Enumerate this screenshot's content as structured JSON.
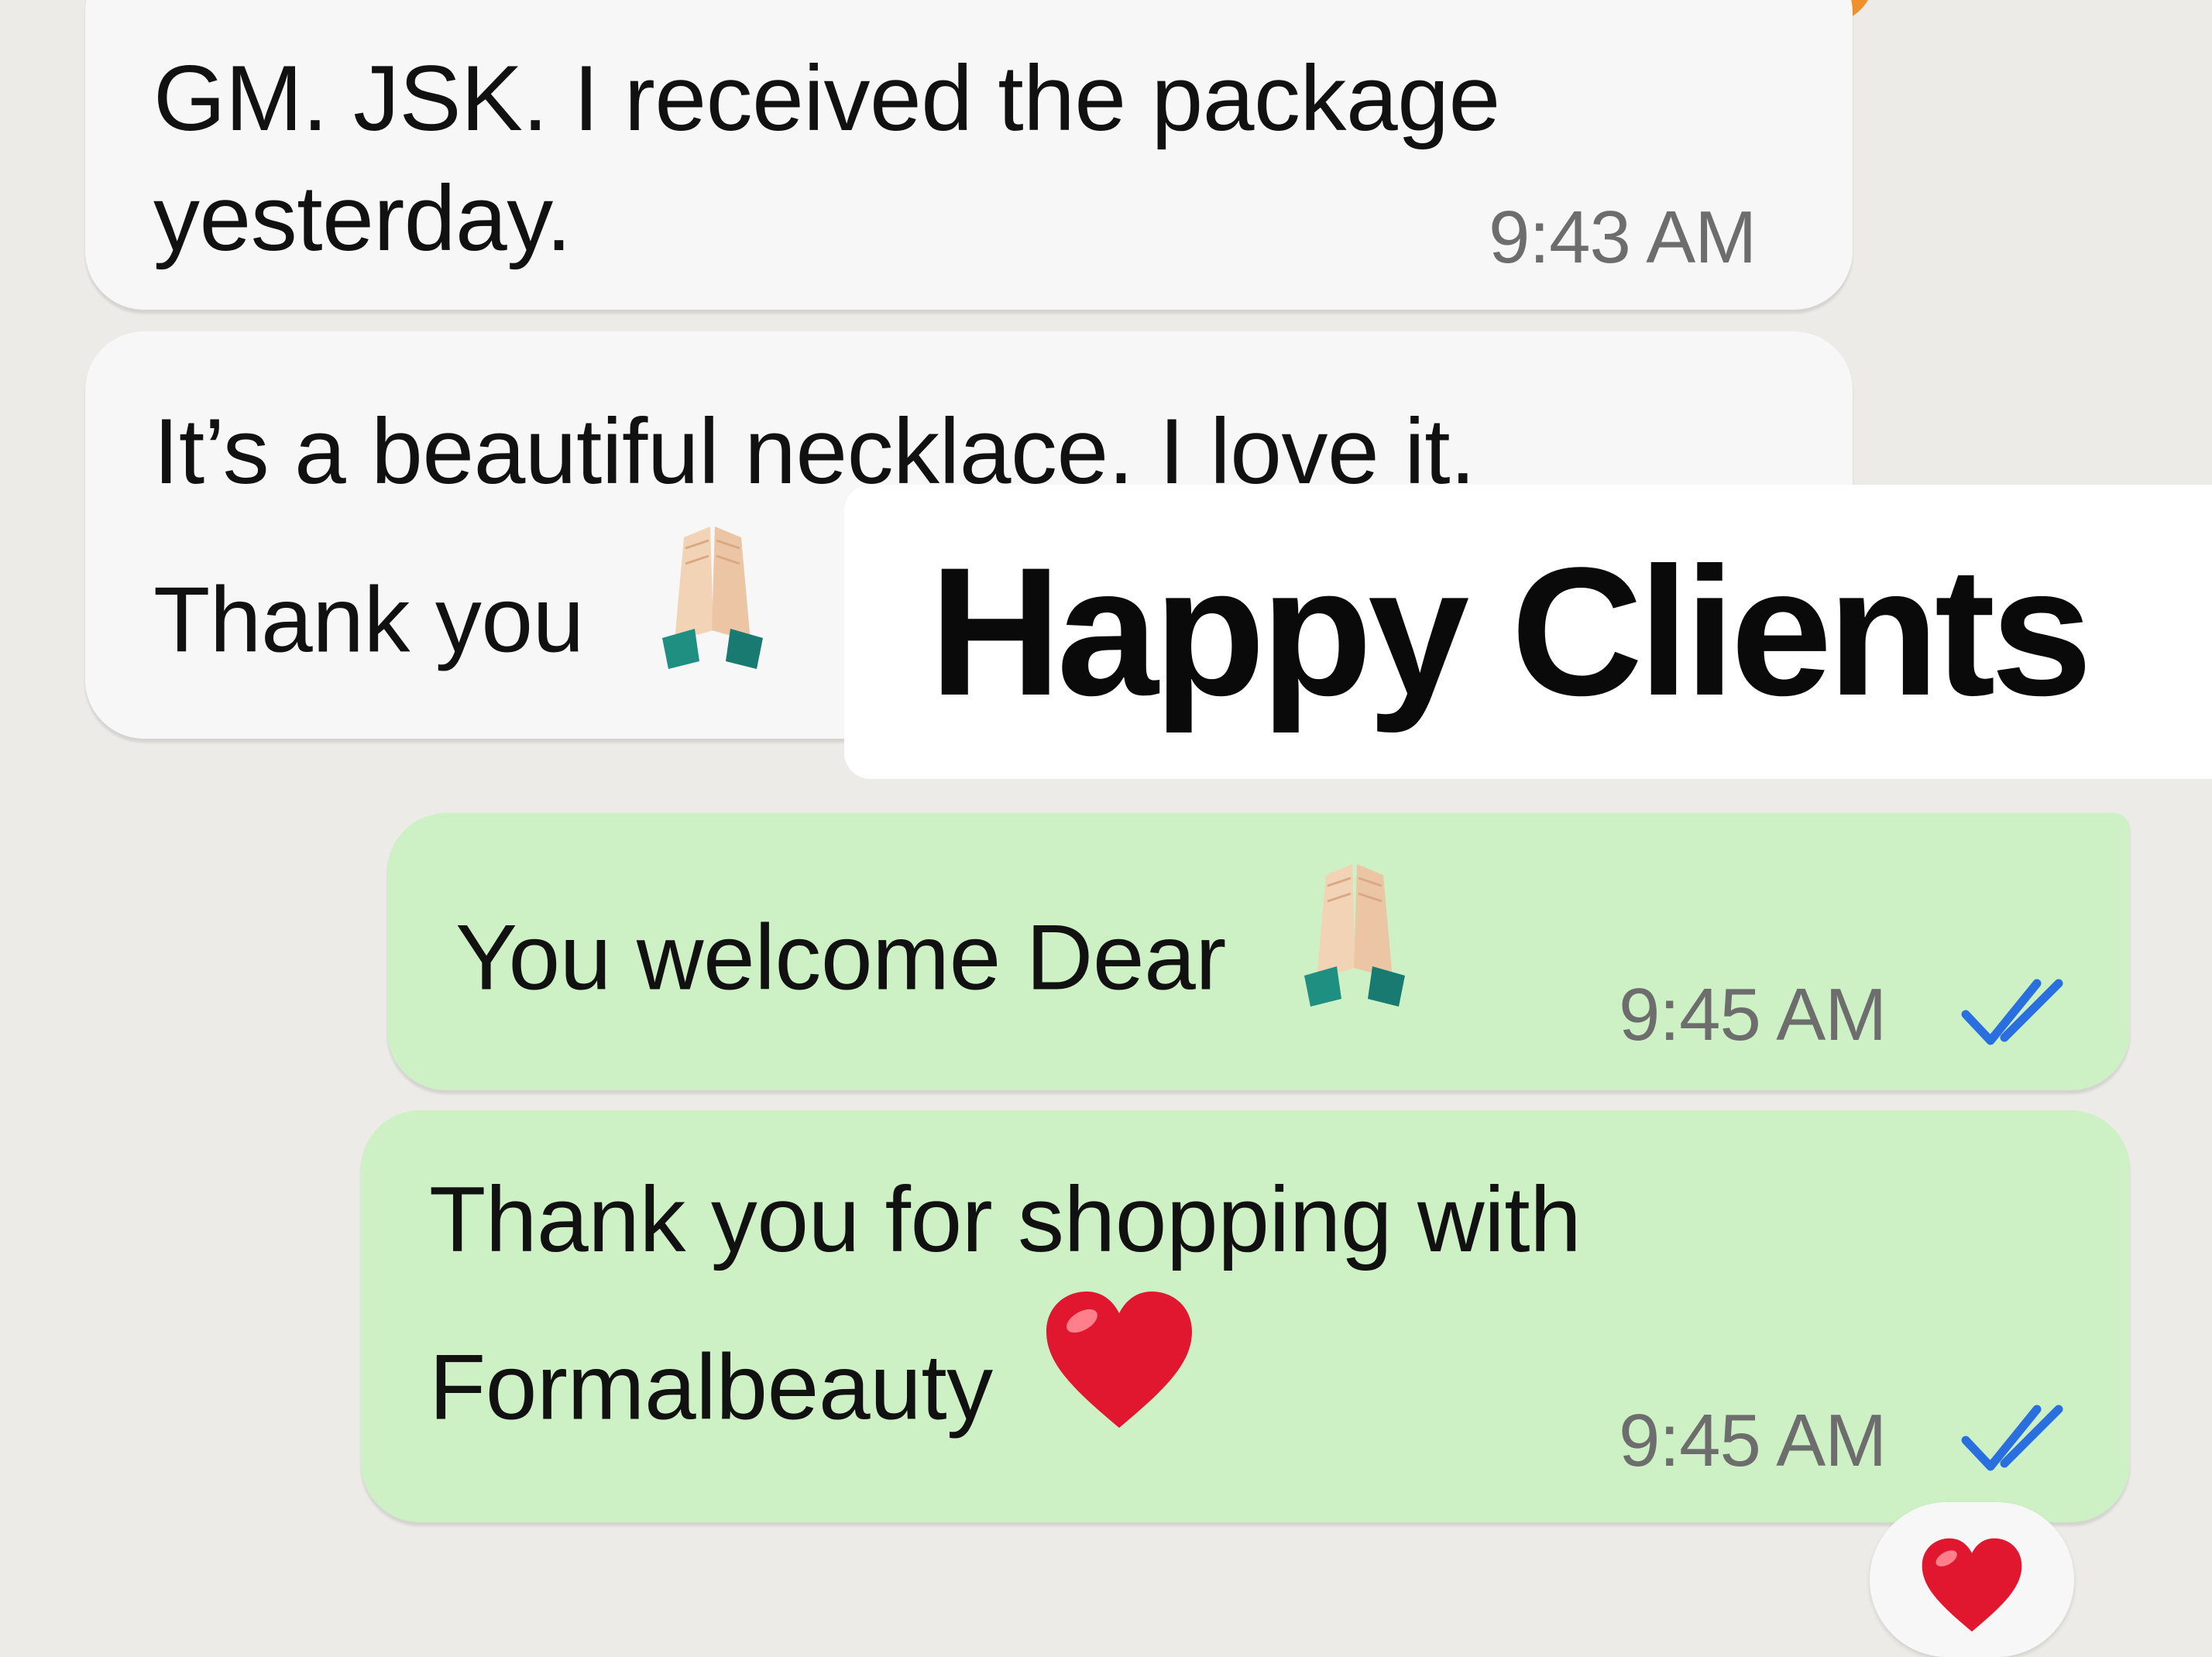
{
  "messages": [
    {
      "direction": "incoming",
      "lines": [
        "GM. JSK. I received the package",
        "yesterday."
      ],
      "time": "9:43 AM"
    },
    {
      "direction": "incoming",
      "lines": [
        "It’s a beautiful necklace. I love it.",
        "Thank you"
      ],
      "emoji": "folded-hands"
    },
    {
      "direction": "outgoing",
      "lines": [
        "You welcome Dear"
      ],
      "emoji": "folded-hands",
      "time": "9:45 AM",
      "status": "read-double-check-icon"
    },
    {
      "direction": "outgoing",
      "lines": [
        "Thank you for shopping with",
        "Formalbeauty"
      ],
      "emoji": "red-heart",
      "time": "9:45 AM",
      "status": "read-double-check-icon",
      "reaction": "red-heart"
    }
  ],
  "overlay": {
    "title": "Happy Clients"
  },
  "colors": {
    "background": "#ecebe8",
    "incoming_bubble": "#f7f7f7",
    "outgoing_bubble": "#cdf0c5",
    "read_ticks": "#2a6fe0",
    "heart": "#e0172e"
  }
}
